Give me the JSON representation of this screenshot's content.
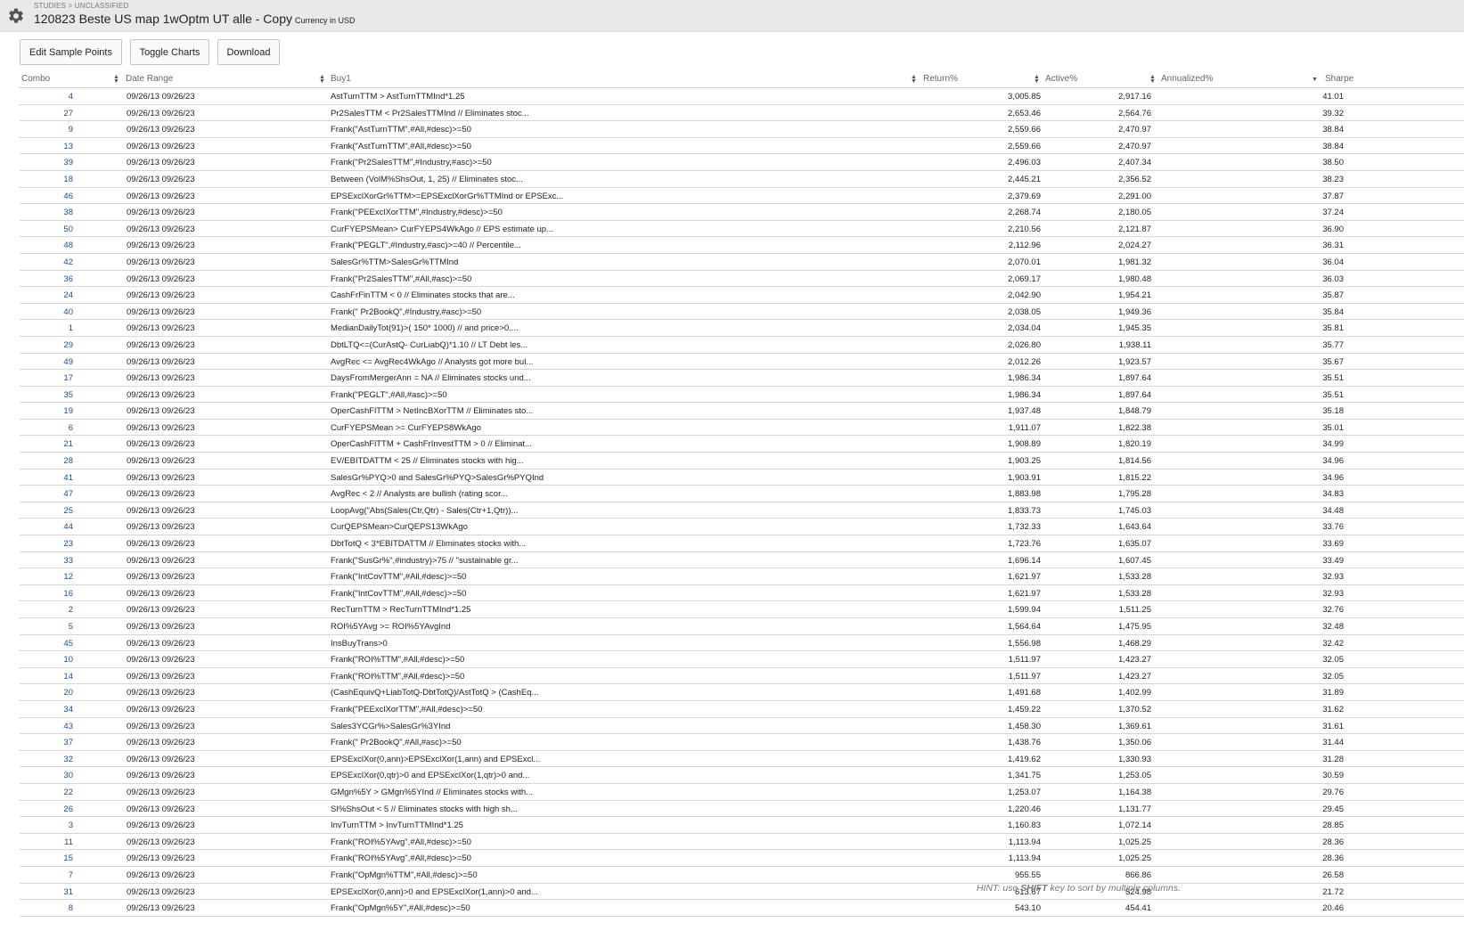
{
  "header": {
    "breadcrumb": "STUDIES > UNCLASSIFIED",
    "title": "120823 Beste US map 1wOptm UT alle - Copy",
    "currency": "Currency in USD"
  },
  "toolbar": {
    "edit_label": "Edit Sample Points",
    "toggle_label": "Toggle Charts",
    "download_label": "Download"
  },
  "table": {
    "columns": [
      "Combo",
      "Date Range",
      "Buy1",
      "Return%",
      "Active%",
      "Annualized%",
      "Sharpe"
    ],
    "rows": [
      [
        "4",
        "09/26/13 09/26/23",
        "AstTurnTTM > AstTurnTTMInd*1.25",
        "3,005.85",
        "2,917.16",
        "41.01"
      ],
      [
        "27",
        "09/26/13 09/26/23",
        "Pr2SalesTTM < Pr2SalesTTMInd // Eliminates stoc...",
        "2,653.46",
        "2,564.76",
        "39.32"
      ],
      [
        "9",
        "09/26/13 09/26/23",
        "Frank(\"AstTurnTTM\",#All,#desc)>=50",
        "2,559.66",
        "2,470.97",
        "38.84"
      ],
      [
        "13",
        "09/26/13 09/26/23",
        "Frank(\"AstTurnTTM\",#All,#desc)>=50",
        "2,559.66",
        "2,470.97",
        "38.84"
      ],
      [
        "39",
        "09/26/13 09/26/23",
        "Frank(\"Pr2SalesTTM\",#Industry,#asc)>=50",
        "2,496.03",
        "2,407.34",
        "38.50"
      ],
      [
        "18",
        "09/26/13 09/26/23",
        "Between (VolM%ShsOut, 1, 25) // Eliminates stoc...",
        "2,445.21",
        "2,356.52",
        "38.23"
      ],
      [
        "46",
        "09/26/13 09/26/23",
        "EPSExclXorGr%TTM>=EPSExclXorGr%TTMInd or EPSExc...",
        "2,379.69",
        "2,291.00",
        "37.87"
      ],
      [
        "38",
        "09/26/13 09/26/23",
        "Frank(\"PEExclXorTTM\",#Industry,#desc)>=50",
        "2,268.74",
        "2,180.05",
        "37.24"
      ],
      [
        "50",
        "09/26/13 09/26/23",
        "CurFYEPSMean> CurFYEPS4WkAgo // EPS estimate up...",
        "2,210.56",
        "2,121.87",
        "36.90"
      ],
      [
        "48",
        "09/26/13 09/26/23",
        "Frank(\"PEGLT\",#Industry,#asc)>=40 // Percentile...",
        "2,112.96",
        "2,024.27",
        "36.31"
      ],
      [
        "42",
        "09/26/13 09/26/23",
        "SalesGr%TTM>SalesGr%TTMInd",
        "2,070.01",
        "1,981.32",
        "36.04"
      ],
      [
        "36",
        "09/26/13 09/26/23",
        "Frank(\"Pr2SalesTTM\",#All,#asc)>=50",
        "2,069.17",
        "1,980.48",
        "36.03"
      ],
      [
        "24",
        "09/26/13 09/26/23",
        "CashFrFinTTM < 0 // Eliminates stocks that are...",
        "2,042.90",
        "1,954.21",
        "35.87"
      ],
      [
        "40",
        "09/26/13 09/26/23",
        "Frank(\" Pr2BookQ\",#Industry,#asc)>=50",
        "2,038.05",
        "1,949.36",
        "35.84"
      ],
      [
        "1",
        "09/26/13 09/26/23",
        "MedianDailyTot(91)>( 150* 1000) // and price>0....",
        "2,034.04",
        "1,945.35",
        "35.81"
      ],
      [
        "29",
        "09/26/13 09/26/23",
        "DbtLTQ<=(CurAstQ- CurLiabQ)*1.10 // LT Debt les...",
        "2,026.80",
        "1,938.11",
        "35.77"
      ],
      [
        "49",
        "09/26/13 09/26/23",
        "AvgRec <= AvgRec4WkAgo // Analysts got more bul...",
        "2,012.26",
        "1,923.57",
        "35.67"
      ],
      [
        "17",
        "09/26/13 09/26/23",
        "DaysFromMergerAnn = NA // Eliminates stocks und...",
        "1,986.34",
        "1,897.64",
        "35.51"
      ],
      [
        "35",
        "09/26/13 09/26/23",
        "Frank(\"PEGLT\",#All,#asc)>=50",
        "1,986.34",
        "1,897.64",
        "35.51"
      ],
      [
        "19",
        "09/26/13 09/26/23",
        "OperCashFlTTM > NetIncBXorTTM // Eliminates sto...",
        "1,937.48",
        "1,848.79",
        "35.18"
      ],
      [
        "6",
        "09/26/13 09/26/23",
        "CurFYEPSMean >= CurFYEPS8WkAgo",
        "1,911.07",
        "1,822.38",
        "35.01"
      ],
      [
        "21",
        "09/26/13 09/26/23",
        "OperCashFlTTM + CashFrInvestTTM > 0 // Eliminat...",
        "1,908.89",
        "1,820.19",
        "34.99"
      ],
      [
        "28",
        "09/26/13 09/26/23",
        "EV/EBITDATTM < 25 // Eliminates stocks with hig...",
        "1,903.25",
        "1,814.56",
        "34.96"
      ],
      [
        "41",
        "09/26/13 09/26/23",
        "SalesGr%PYQ>0 and SalesGr%PYQ>SalesGr%PYQInd",
        "1,903.91",
        "1,815.22",
        "34.96"
      ],
      [
        "47",
        "09/26/13 09/26/23",
        "AvgRec < 2 // Analysts are bullish (rating scor...",
        "1,883.98",
        "1,795.28",
        "34.83"
      ],
      [
        "25",
        "09/26/13 09/26/23",
        "LoopAvg(\"Abs(Sales(Ctr,Qtr) - Sales(Ctr+1,Qtr))...",
        "1,833.73",
        "1,745.03",
        "34.48"
      ],
      [
        "44",
        "09/26/13 09/26/23",
        "CurQEPSMean>CurQEPS13WkAgo",
        "1,732.33",
        "1,643.64",
        "33.76"
      ],
      [
        "23",
        "09/26/13 09/26/23",
        "DbtTotQ < 3*EBITDATTM // Eliminates stocks with...",
        "1,723.76",
        "1,635.07",
        "33.69"
      ],
      [
        "33",
        "09/26/13 09/26/23",
        "Frank(\"SusGr%\",#industry)>75 // \"sustainable gr...",
        "1,696.14",
        "1,607.45",
        "33.49"
      ],
      [
        "12",
        "09/26/13 09/26/23",
        "Frank(\"IntCovTTM\",#All,#desc)>=50",
        "1,621.97",
        "1,533.28",
        "32.93"
      ],
      [
        "16",
        "09/26/13 09/26/23",
        "Frank(\"IntCovTTM\",#All,#desc)>=50",
        "1,621.97",
        "1,533.28",
        "32.93"
      ],
      [
        "2",
        "09/26/13 09/26/23",
        "RecTurnTTM > RecTurnTTMInd*1.25",
        "1,599.94",
        "1,511.25",
        "32.76"
      ],
      [
        "5",
        "09/26/13 09/26/23",
        "ROI%5YAvg >= ROI%5YAvgInd",
        "1,564.64",
        "1,475.95",
        "32.48"
      ],
      [
        "45",
        "09/26/13 09/26/23",
        "InsBuyTrans>0",
        "1,556.98",
        "1,468.29",
        "32.42"
      ],
      [
        "10",
        "09/26/13 09/26/23",
        "Frank(\"ROI%TTM\",#All,#desc)>=50",
        "1,511.97",
        "1,423.27",
        "32.05"
      ],
      [
        "14",
        "09/26/13 09/26/23",
        "Frank(\"ROI%TTM\",#All,#desc)>=50",
        "1,511.97",
        "1,423.27",
        "32.05"
      ],
      [
        "20",
        "09/26/13 09/26/23",
        "(CashEquivQ+LiabTotQ-DbtTotQ)/AstTotQ > (CashEq...",
        "1,491.68",
        "1,402.99",
        "31.89"
      ],
      [
        "34",
        "09/26/13 09/26/23",
        "Frank(\"PEExclXorTTM\",#All,#desc)>=50",
        "1,459.22",
        "1,370.52",
        "31.62"
      ],
      [
        "43",
        "09/26/13 09/26/23",
        "Sales3YCGr%>SalesGr%3YInd",
        "1,458.30",
        "1,369.61",
        "31.61"
      ],
      [
        "37",
        "09/26/13 09/26/23",
        "Frank(\" Pr2BookQ\",#All,#asc)>=50",
        "1,438.76",
        "1,350.06",
        "31.44"
      ],
      [
        "32",
        "09/26/13 09/26/23",
        "EPSExclXor(0,ann)>EPSExclXor(1,ann) and EPSExcl...",
        "1,419.62",
        "1,330.93",
        "31.28"
      ],
      [
        "30",
        "09/26/13 09/26/23",
        "EPSExclXor(0,qtr)>0 and EPSExclXor(1,qtr)>0 and...",
        "1,341.75",
        "1,253.05",
        "30.59"
      ],
      [
        "22",
        "09/26/13 09/26/23",
        "GMgn%5Y > GMgn%5YInd // Eliminates stocks with...",
        "1,253.07",
        "1,164.38",
        "29.76"
      ],
      [
        "26",
        "09/26/13 09/26/23",
        "SI%ShsOut < 5 // Eliminates stocks with high sh...",
        "1,220.46",
        "1,131.77",
        "29.45"
      ],
      [
        "3",
        "09/26/13 09/26/23",
        "InvTurnTTM > InvTurnTTMInd*1.25",
        "1,160.83",
        "1,072.14",
        "28.85"
      ],
      [
        "11",
        "09/26/13 09/26/23",
        "Frank(\"ROI%5YAvg\",#All,#desc)>=50",
        "1,113.94",
        "1,025.25",
        "28.36"
      ],
      [
        "15",
        "09/26/13 09/26/23",
        "Frank(\"ROI%5YAvg\",#All,#desc)>=50",
        "1,113.94",
        "1,025.25",
        "28.36"
      ],
      [
        "7",
        "09/26/13 09/26/23",
        "Frank(\"OpMgn%TTM\",#All,#desc)>=50",
        "955.55",
        "866.86",
        "26.58"
      ],
      [
        "31",
        "09/26/13 09/26/23",
        "EPSExclXor(0,ann)>0 and EPSExclXor(1,ann)>0 and...",
        "613.67",
        "524.98",
        "21.72"
      ],
      [
        "8",
        "09/26/13 09/26/23",
        "Frank(\"OpMgn%5Y\",#All,#desc)>=50",
        "543.10",
        "454.41",
        "20.46"
      ]
    ]
  },
  "hint": {
    "prefix": "HINT: use ",
    "key": "SHIFT",
    "suffix": " key to sort by multiple columns."
  },
  "colors": {
    "link": "#1a4e9c",
    "header_bg": "#e9e9e9",
    "row_border": "#d6d6d6"
  },
  "icons": {
    "settings": "gear-icon",
    "sort": "sort-icon",
    "sort_desc": "sort-desc-icon"
  }
}
